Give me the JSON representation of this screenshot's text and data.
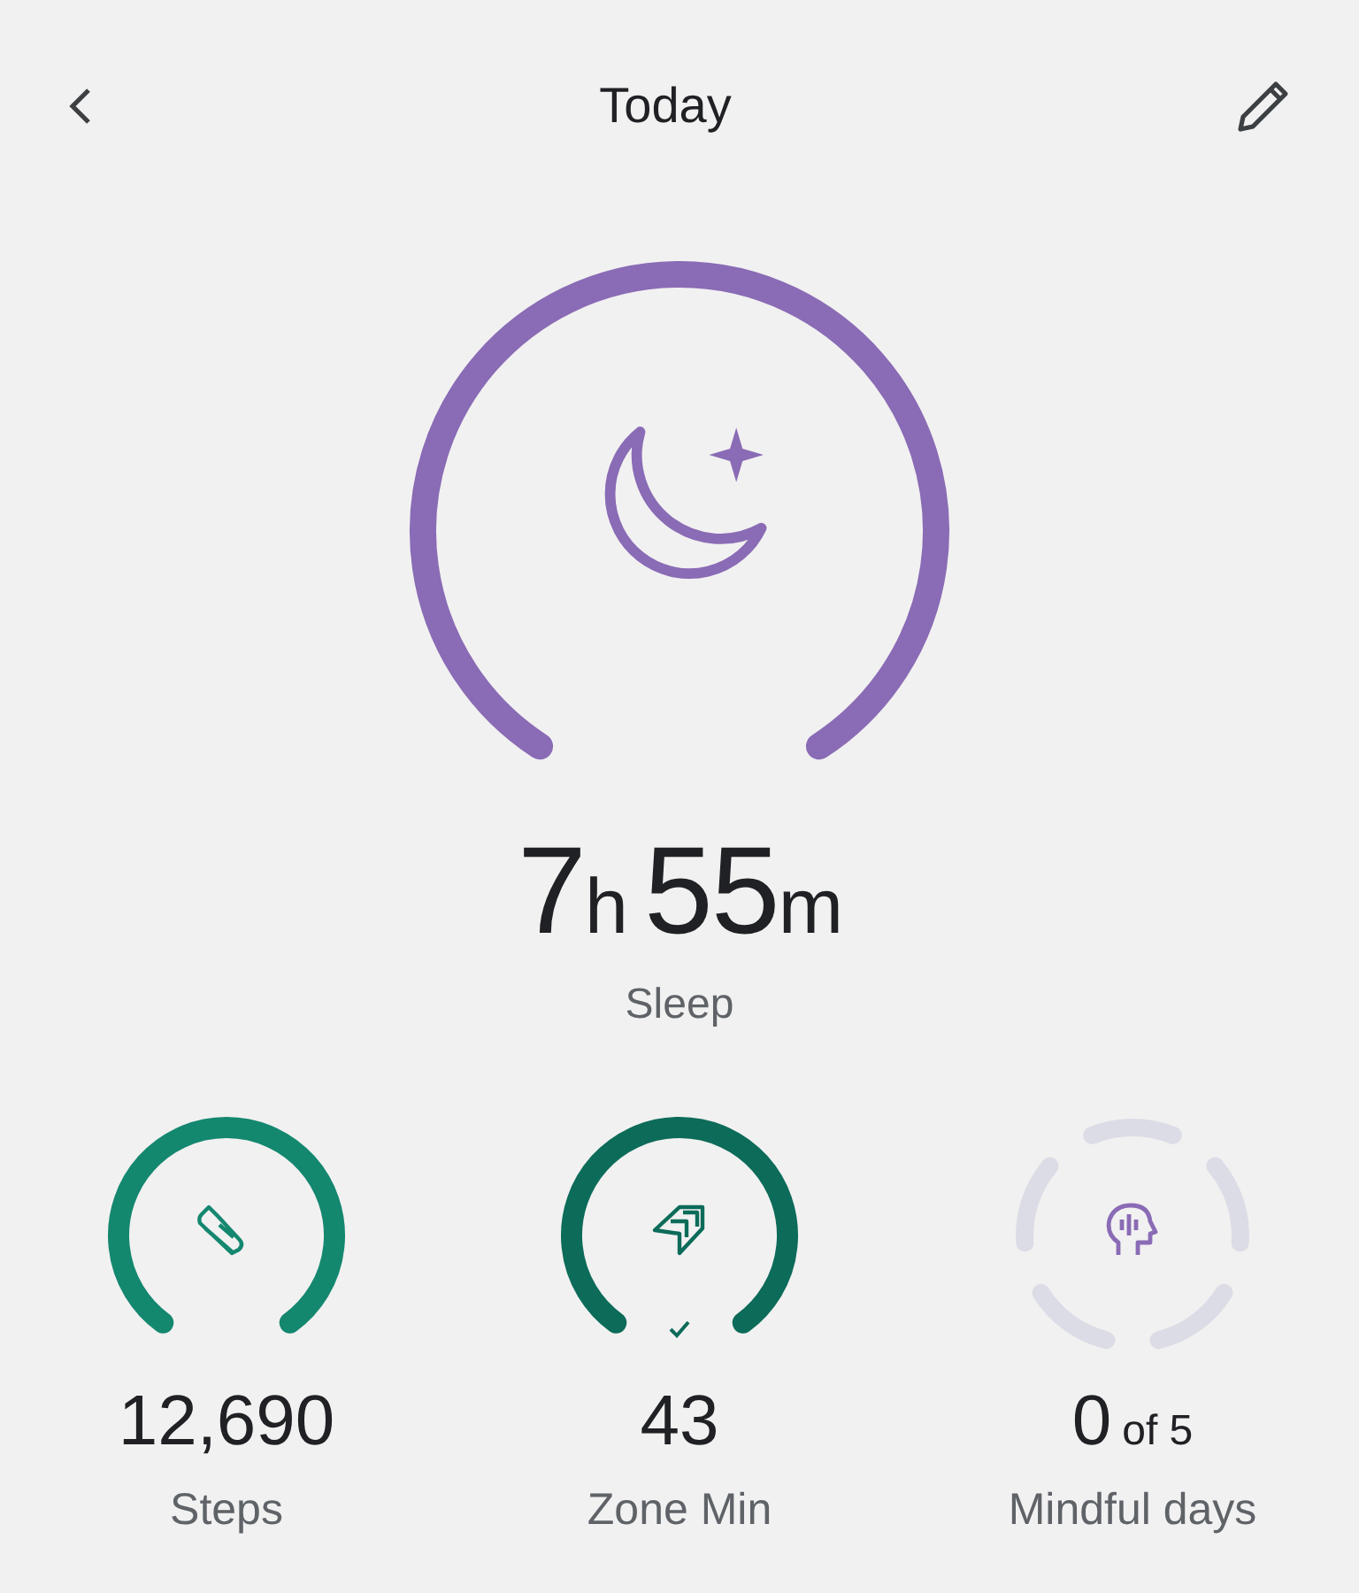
{
  "header": {
    "title": "Today"
  },
  "main": {
    "label": "Sleep",
    "color": "#8a6bb5",
    "value_parts": [
      {
        "number": "7",
        "unit": "h"
      },
      {
        "number": "55",
        "unit": "m"
      }
    ]
  },
  "metrics": [
    {
      "kind": "arc",
      "label": "Steps",
      "value": "12,690",
      "color": "#14876f",
      "goal_met": false
    },
    {
      "kind": "arc",
      "label": "Zone Min",
      "value": "43",
      "color": "#0c6b59",
      "goal_met": true
    },
    {
      "kind": "segments",
      "label": "Mindful days",
      "value": "0",
      "suffix": "of 5",
      "color": "#8a6bb5",
      "goal_met": false
    }
  ]
}
